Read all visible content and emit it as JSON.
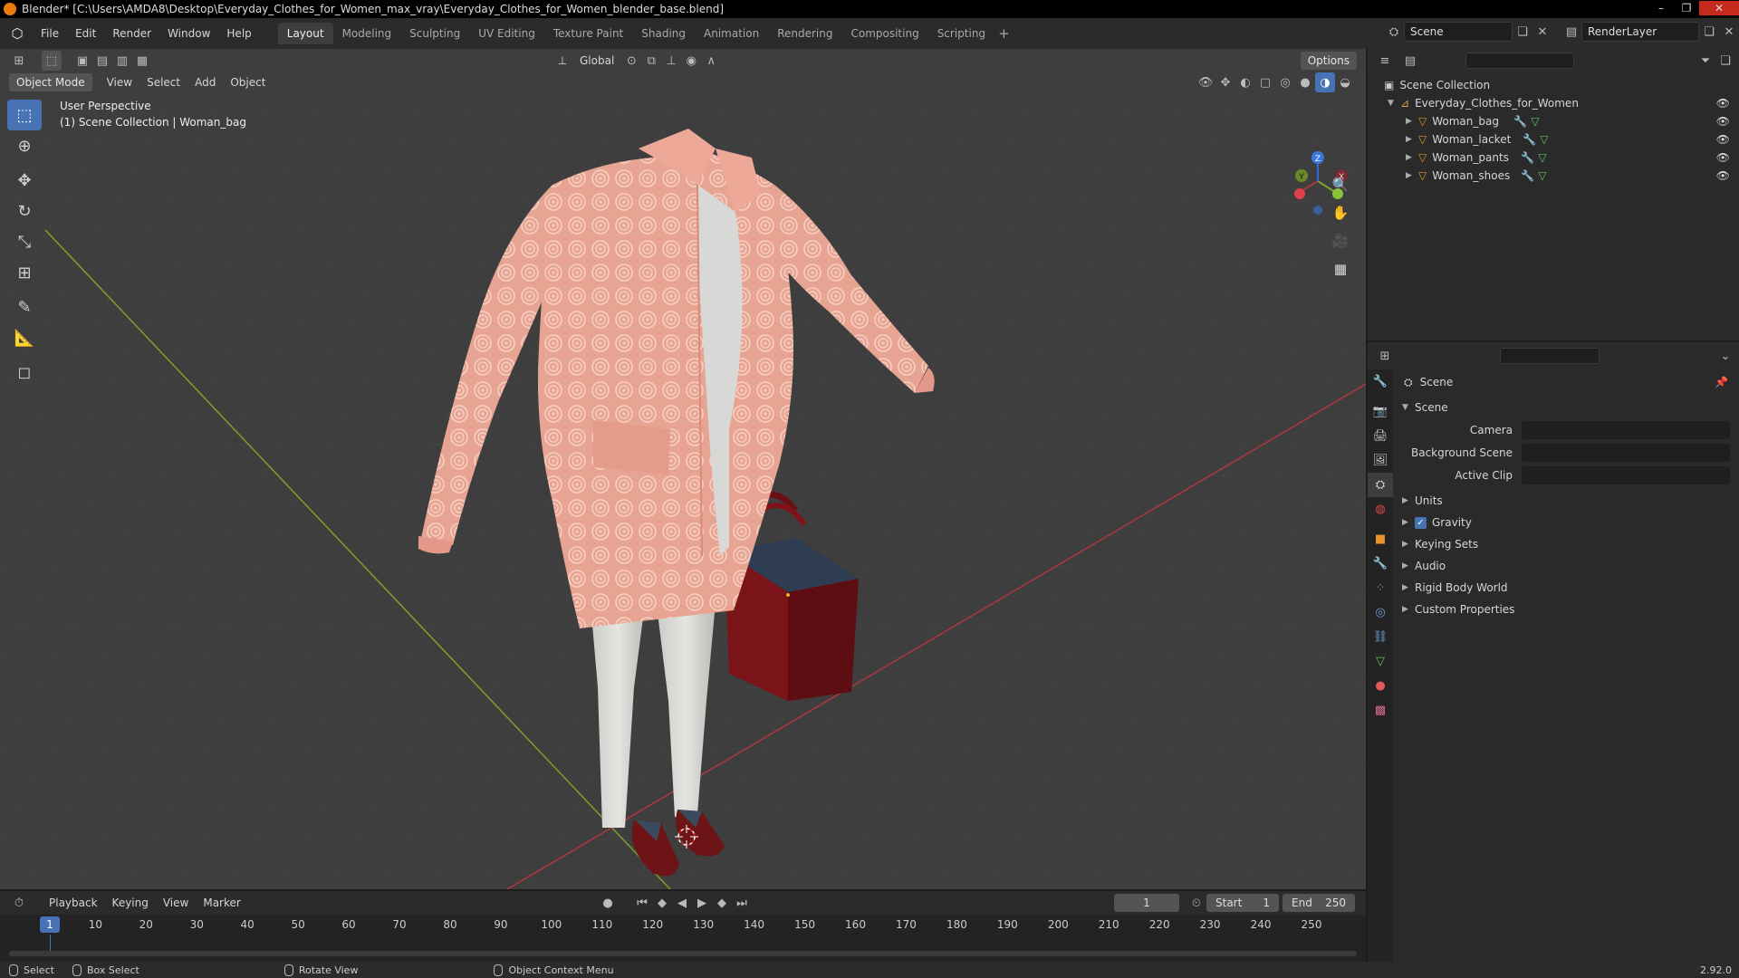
{
  "window": {
    "title": "Blender* [C:\\Users\\AMDA8\\Desktop\\Everyday_Clothes_for_Women_max_vray\\Everyday_Clothes_for_Women_blender_base.blend]",
    "min": "–",
    "max": "❐",
    "close": "✕"
  },
  "menu": [
    "File",
    "Edit",
    "Render",
    "Window",
    "Help"
  ],
  "workspaces": [
    "Layout",
    "Modeling",
    "Sculpting",
    "UV Editing",
    "Texture Paint",
    "Shading",
    "Animation",
    "Rendering",
    "Compositing",
    "Scripting"
  ],
  "scene_name": "Scene",
  "view_layer": "RenderLayer",
  "viewport": {
    "mode": "Object Mode",
    "menus": [
      "View",
      "Select",
      "Add",
      "Object"
    ],
    "transform_orientation": "Global",
    "options_label": "Options",
    "perspective": "User Perspective",
    "collection_info": "(1) Scene Collection | Woman_bag",
    "axes": {
      "x": "X",
      "y": "Y",
      "z": "Z"
    }
  },
  "outliner": {
    "root": "Scene Collection",
    "collection": "Everyday_Clothes_for_Women",
    "objects": [
      "Woman_bag",
      "Woman_lacket",
      "Woman_pants",
      "Woman_shoes"
    ]
  },
  "properties": {
    "header": "Scene",
    "panel": "Scene",
    "fields": {
      "camera": "Camera",
      "background_scene": "Background Scene",
      "active_clip": "Active Clip"
    },
    "subpanels": [
      "Units",
      "Gravity",
      "Keying Sets",
      "Audio",
      "Rigid Body World",
      "Custom Properties"
    ],
    "gravity_checked": true
  },
  "timeline": {
    "menus": [
      "Playback",
      "Keying",
      "View",
      "Marker"
    ],
    "current_frame": "1",
    "start_label": "Start",
    "start": "1",
    "end_label": "End",
    "end": "250",
    "ruler": [
      "10",
      "20",
      "30",
      "40",
      "50",
      "60",
      "70",
      "80",
      "90",
      "100",
      "110",
      "120",
      "130",
      "140",
      "150",
      "160",
      "170",
      "180",
      "190",
      "200",
      "210",
      "220",
      "230",
      "240",
      "250"
    ],
    "playhead": "1"
  },
  "status": {
    "select": "Select",
    "box_select": "Box Select",
    "rotate_view": "Rotate View",
    "context_menu": "Object Context Menu",
    "version": "2.92.0"
  },
  "colors": {
    "accent": "#4772b3",
    "jacket": "#e8a090",
    "pants": "#d9dad6",
    "bag": "#7a1418"
  }
}
